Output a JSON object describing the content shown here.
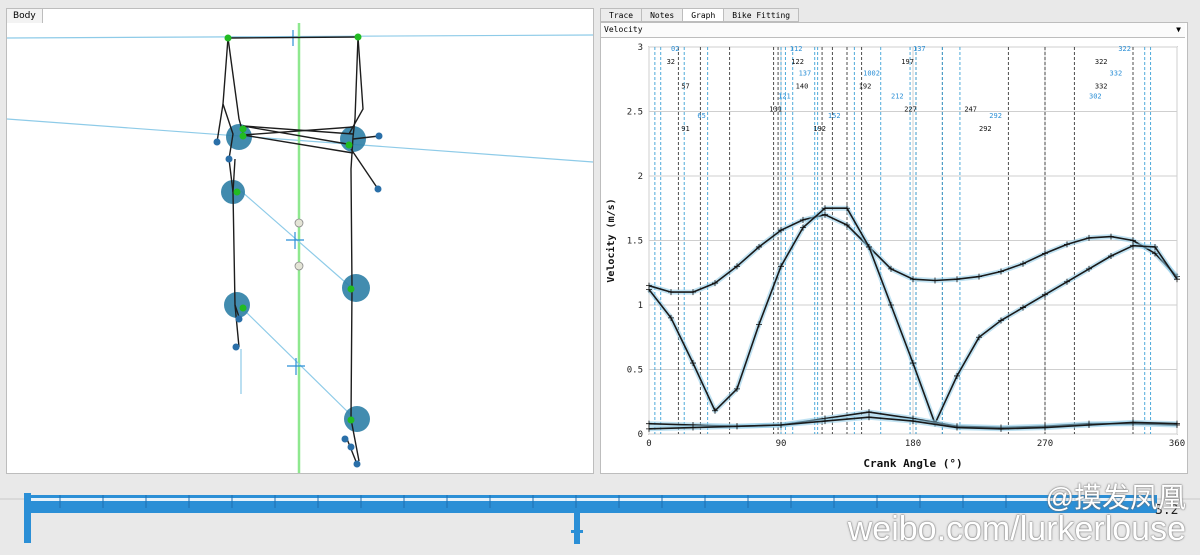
{
  "body_tab": {
    "label": "Body"
  },
  "tabs": [
    {
      "label": "Trace",
      "active": false
    },
    {
      "label": "Notes",
      "active": false
    },
    {
      "label": "Graph",
      "active": true
    },
    {
      "label": "Bike Fitting",
      "active": false
    }
  ],
  "dropdown": {
    "value": "Velocity",
    "arrow": "▼"
  },
  "chart_data": {
    "type": "line",
    "xlabel": "Crank Angle (°)",
    "ylabel": "Velocity (m/s)",
    "xlim": [
      0,
      360
    ],
    "ylim": [
      0,
      3
    ],
    "x_ticks": [
      "0",
      "90",
      "180",
      "270",
      "360"
    ],
    "y_ticks": [
      "0",
      "0.5",
      "1",
      "1.5",
      "2",
      "2.5",
      "3"
    ],
    "grid": true,
    "series": [
      {
        "color": "#1a1a1a",
        "x": [
          0,
          15,
          30,
          45,
          60,
          75,
          90,
          105,
          120,
          135,
          150,
          165,
          180,
          195,
          210,
          225,
          240,
          255,
          270,
          285,
          300,
          315,
          330,
          345,
          360
        ],
        "values": [
          1.15,
          1.1,
          1.1,
          1.17,
          1.3,
          1.45,
          1.58,
          1.66,
          1.7,
          1.62,
          1.45,
          1.28,
          1.2,
          1.19,
          1.2,
          1.22,
          1.26,
          1.32,
          1.4,
          1.47,
          1.52,
          1.53,
          1.5,
          1.4,
          1.22
        ]
      },
      {
        "color": "#1a1a1a",
        "x": [
          0,
          15,
          30,
          45,
          60,
          75,
          90,
          105,
          120,
          135,
          150,
          165,
          180,
          195,
          210,
          225,
          240,
          255,
          270,
          285,
          300,
          315,
          330,
          345,
          360
        ],
        "values": [
          1.12,
          0.9,
          0.55,
          0.18,
          0.35,
          0.85,
          1.3,
          1.6,
          1.75,
          1.75,
          1.45,
          1.0,
          0.55,
          0.08,
          0.45,
          0.75,
          0.88,
          0.98,
          1.08,
          1.18,
          1.28,
          1.38,
          1.46,
          1.45,
          1.2
        ]
      },
      {
        "color": "#1a1a1a",
        "x": [
          0,
          30,
          60,
          90,
          120,
          150,
          180,
          210,
          240,
          270,
          300,
          330,
          360
        ],
        "values": [
          0.08,
          0.07,
          0.06,
          0.07,
          0.12,
          0.17,
          0.12,
          0.06,
          0.05,
          0.06,
          0.08,
          0.08,
          0.07
        ]
      },
      {
        "color": "#1a1a1a",
        "x": [
          0,
          30,
          60,
          90,
          120,
          150,
          180,
          210,
          240,
          270,
          300,
          330,
          360
        ],
        "values": [
          0.04,
          0.05,
          0.06,
          0.07,
          0.1,
          0.13,
          0.1,
          0.05,
          0.04,
          0.05,
          0.07,
          0.09,
          0.08
        ]
      }
    ],
    "vlines_black": [
      20,
      35,
      55,
      85,
      88,
      118,
      125,
      135,
      145,
      182,
      200,
      245,
      270,
      290,
      330
    ],
    "vlines_blue": [
      4,
      8,
      24,
      40,
      90,
      93,
      98,
      113,
      115,
      140,
      158,
      178,
      182,
      200,
      212,
      338,
      342
    ],
    "annotations_black": [
      {
        "text": "32",
        "x": 12,
        "y": 2.87
      },
      {
        "text": "57",
        "x": 22,
        "y": 2.68
      },
      {
        "text": "91",
        "x": 22,
        "y": 2.35
      },
      {
        "text": "122",
        "x": 97,
        "y": 2.87
      },
      {
        "text": "140",
        "x": 100,
        "y": 2.68
      },
      {
        "text": "131",
        "x": 82,
        "y": 2.5
      },
      {
        "text": "192",
        "x": 112,
        "y": 2.35
      },
      {
        "text": "192",
        "x": 143,
        "y": 2.68
      },
      {
        "text": "197",
        "x": 172,
        "y": 2.87
      },
      {
        "text": "227",
        "x": 174,
        "y": 2.5
      },
      {
        "text": "247",
        "x": 215,
        "y": 2.5
      },
      {
        "text": "292",
        "x": 225,
        "y": 2.35
      },
      {
        "text": "322",
        "x": 304,
        "y": 2.87
      },
      {
        "text": "332",
        "x": 304,
        "y": 2.68
      }
    ],
    "annotations_blue": [
      {
        "text": "02",
        "x": 15,
        "y": 2.97
      },
      {
        "text": "65",
        "x": 33,
        "y": 2.45
      },
      {
        "text": "112",
        "x": 96,
        "y": 2.97
      },
      {
        "text": "137",
        "x": 102,
        "y": 2.78
      },
      {
        "text": "121",
        "x": 88,
        "y": 2.6
      },
      {
        "text": "152",
        "x": 122,
        "y": 2.45
      },
      {
        "text": "1002",
        "x": 146,
        "y": 2.78
      },
      {
        "text": "137",
        "x": 180,
        "y": 2.97
      },
      {
        "text": "212",
        "x": 165,
        "y": 2.6
      },
      {
        "text": "292",
        "x": 232,
        "y": 2.45
      },
      {
        "text": "322",
        "x": 320,
        "y": 2.97
      },
      {
        "text": "332",
        "x": 314,
        "y": 2.78
      },
      {
        "text": "302",
        "x": 300,
        "y": 2.6
      }
    ]
  },
  "timeline": {
    "end_value": "3.2"
  },
  "watermark": {
    "line1": "@摸发凤凰",
    "line2": "weibo.com/lurkerlouse"
  },
  "colors": {
    "accent_blue": "#2b8fd6",
    "skeleton": "#1d1d1d",
    "joint_green": "#22bb22",
    "joint_blue": "#2a6fa8",
    "guide_green": "#8fe88f",
    "guide_blue": "#8ecbe8"
  }
}
